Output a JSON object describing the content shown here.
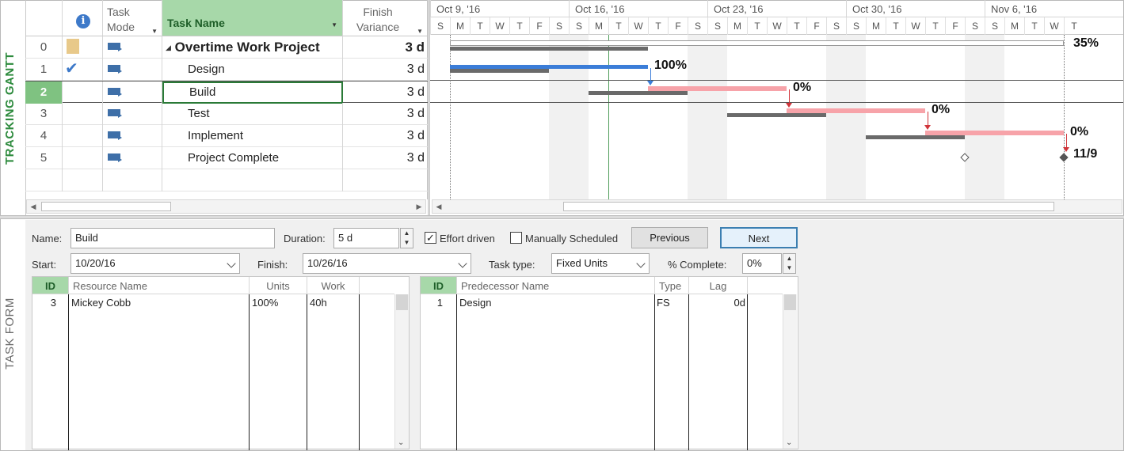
{
  "side_labels": {
    "upper": "TRACKING GANTT",
    "lower": "TASK FORM"
  },
  "sheet": {
    "headers": {
      "info": "i",
      "task_mode": "Task Mode",
      "task_name": "Task Name",
      "finish_variance": "Finish Variance"
    },
    "rows": [
      {
        "id": "0",
        "name": "Overtime Work Project",
        "variance": "3 d",
        "summary": true,
        "indicator": "note-icon"
      },
      {
        "id": "1",
        "name": "Design",
        "variance": "3 d",
        "indicator": "checkmark-icon"
      },
      {
        "id": "2",
        "name": "Build",
        "variance": "3 d",
        "selected": true
      },
      {
        "id": "3",
        "name": "Test",
        "variance": "3 d"
      },
      {
        "id": "4",
        "name": "Implement",
        "variance": "3 d"
      },
      {
        "id": "5",
        "name": "Project Complete",
        "variance": "3 d"
      }
    ]
  },
  "timeline": {
    "weeks": [
      "Oct 9, '16",
      "Oct 16, '16",
      "Oct 23, '16",
      "Oct 30, '16",
      "Nov 6, '16"
    ],
    "days": [
      "S",
      "M",
      "T",
      "W",
      "T",
      "F",
      "S",
      "S",
      "M",
      "T",
      "W",
      "T",
      "F",
      "S",
      "S",
      "M",
      "T",
      "W",
      "T",
      "F",
      "S",
      "S",
      "M",
      "T",
      "W",
      "T",
      "F",
      "S",
      "S",
      "M",
      "T",
      "W",
      "T"
    ]
  },
  "gantt_labels": {
    "summary": "35%",
    "design": "100%",
    "build": "0%",
    "test": "0%",
    "implement": "0%",
    "complete": "11/9"
  },
  "colors": {
    "selection": "#7fc281",
    "header_green": "#a7d8a9",
    "actual_blue": "#3b7dd8",
    "planned_red": "#f7a3a9",
    "baseline": "#666666",
    "arrow_red": "#d0343a"
  },
  "form": {
    "name_label": "Name:",
    "name_value": "Build",
    "duration_label": "Duration:",
    "duration_value": "5 d",
    "effort_driven_label": "Effort driven",
    "effort_driven_checked": true,
    "manual_label": "Manually Scheduled",
    "manual_checked": false,
    "previous_label": "Previous",
    "next_label": "Next",
    "start_label": "Start:",
    "start_value": "10/20/16",
    "finish_label": "Finish:",
    "finish_value": "10/26/16",
    "task_type_label": "Task type:",
    "task_type_value": "Fixed Units",
    "complete_label": "% Complete:",
    "complete_value": "0%"
  },
  "resources": {
    "headers": [
      "ID",
      "Resource Name",
      "Units",
      "Work"
    ],
    "rows": [
      {
        "id": "3",
        "name": "Mickey Cobb",
        "units": "100%",
        "work": "40h"
      }
    ]
  },
  "predecessors": {
    "headers": [
      "ID",
      "Predecessor Name",
      "Type",
      "Lag"
    ],
    "rows": [
      {
        "id": "1",
        "name": "Design",
        "type": "FS",
        "lag": "0d"
      }
    ]
  }
}
